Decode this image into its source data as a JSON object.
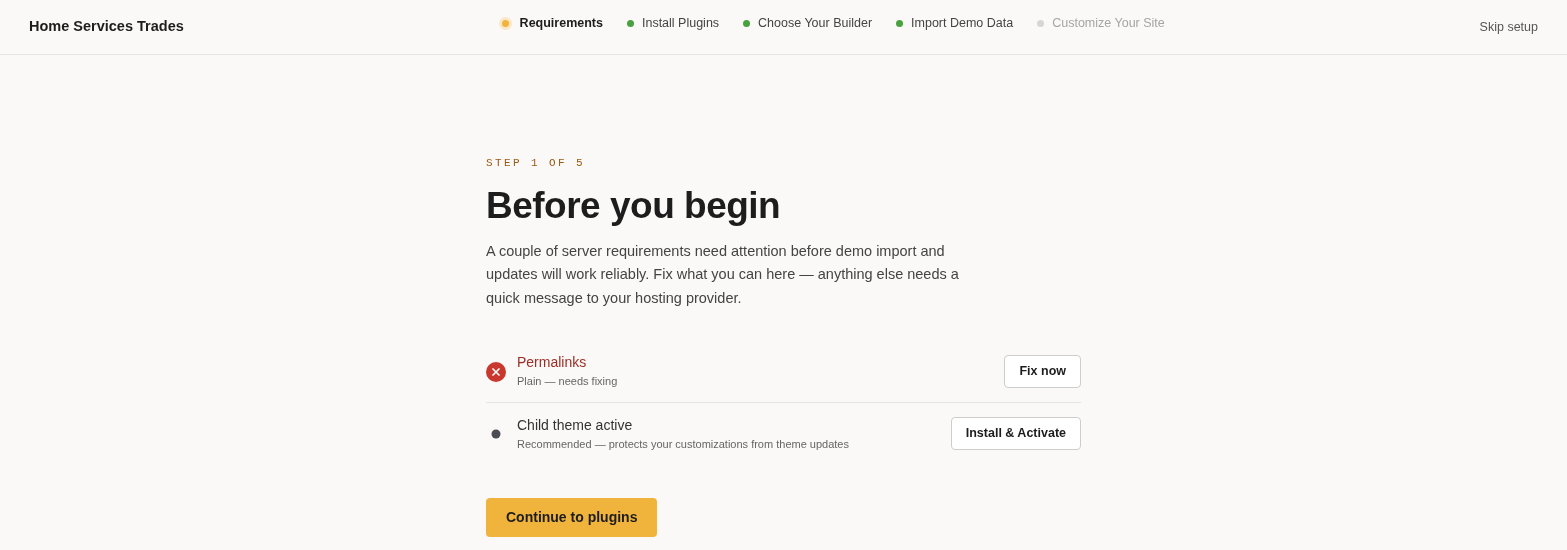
{
  "brand": "Home Services Trades",
  "steps": [
    {
      "label": "Requirements",
      "kind": "current"
    },
    {
      "label": "Install Plugins",
      "kind": "done"
    },
    {
      "label": "Choose Your Builder",
      "kind": "done"
    },
    {
      "label": "Import Demo Data",
      "kind": "done"
    },
    {
      "label": "Customize Your Site",
      "kind": "pending"
    }
  ],
  "skip_link": "Skip setup",
  "eyebrow": "STEP 1 OF 5",
  "heading": "Before you begin",
  "intro": "A couple of server requirements need attention before demo import and updates will work reliably. Fix what you can here — anything else needs a quick message to your hosting provider.",
  "requirements": [
    {
      "title": "Permalinks",
      "detail": "Plain — needs fixing",
      "kind": "error",
      "action": "Fix now"
    },
    {
      "title": "Child theme active",
      "detail": "Recommended — protects your customizations from theme updates",
      "kind": "recommended",
      "action": "Install & Activate"
    }
  ],
  "continue_button": "Continue to plugins"
}
